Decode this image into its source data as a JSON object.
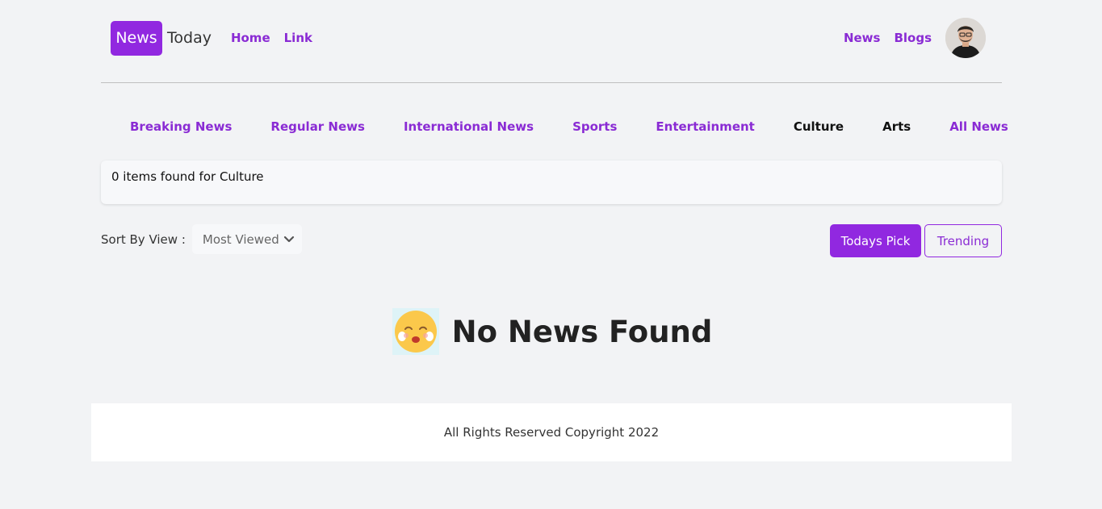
{
  "brand": {
    "badge": "News",
    "rest": "Today"
  },
  "nav_left": [
    {
      "label": "Home"
    },
    {
      "label": "Link"
    }
  ],
  "nav_right": [
    {
      "label": "News"
    },
    {
      "label": "Blogs"
    }
  ],
  "categories": [
    {
      "label": "Breaking News",
      "color": "#8a2bd4"
    },
    {
      "label": "Regular News",
      "color": "#8a2bd4"
    },
    {
      "label": "International News",
      "color": "#8a2bd4"
    },
    {
      "label": "Sports",
      "color": "#8a2bd4"
    },
    {
      "label": "Entertainment",
      "color": "#8a2bd4"
    },
    {
      "label": "Culture",
      "color": "#111111"
    },
    {
      "label": "Arts",
      "color": "#111111"
    },
    {
      "label": "All News",
      "color": "#8a2bd4"
    }
  ],
  "result": {
    "text": "0 items found for Culture"
  },
  "sort": {
    "label": "Sort By View :",
    "selected": "Most Viewed"
  },
  "buttons": {
    "primary": "Todays Pick",
    "outline": "Trending"
  },
  "empty": {
    "icon": "crying-face-icon",
    "title": "No News Found"
  },
  "footer": {
    "text": "All Rights Reserved Copyright 2022"
  },
  "colors": {
    "accent": "#9128e0",
    "background": "#f2f3f5"
  }
}
